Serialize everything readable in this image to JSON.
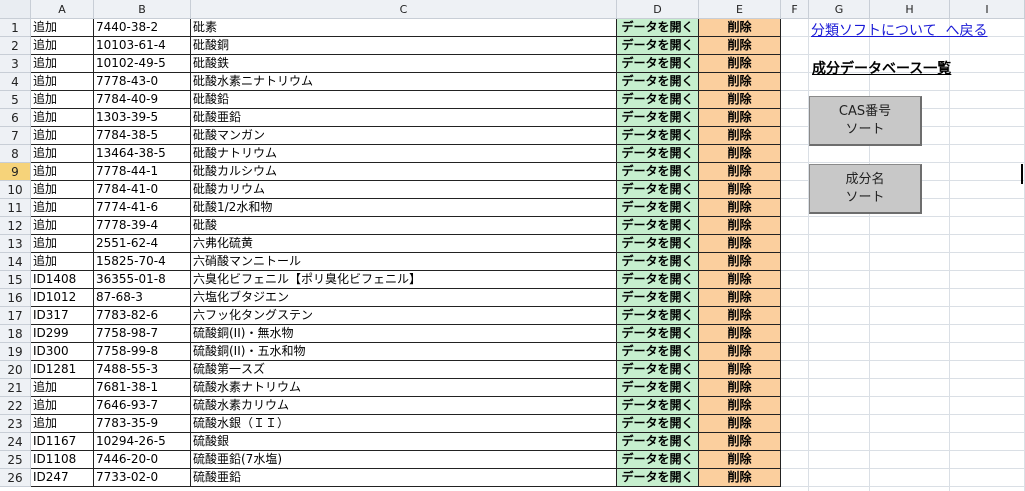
{
  "columns": [
    "A",
    "B",
    "C",
    "D",
    "E",
    "F",
    "G",
    "H",
    "I"
  ],
  "buttons": {
    "open_label": "データを開く",
    "delete_label": "削除"
  },
  "rows": [
    {
      "num": "1",
      "a": "追加",
      "b": "7440-38-2",
      "c": "砒素"
    },
    {
      "num": "2",
      "a": "追加",
      "b": "10103-61-4",
      "c": "砒酸銅"
    },
    {
      "num": "3",
      "a": "追加",
      "b": "10102-49-5",
      "c": "砒酸鉄"
    },
    {
      "num": "4",
      "a": "追加",
      "b": "7778-43-0",
      "c": "砒酸水素ニナトリウム"
    },
    {
      "num": "5",
      "a": "追加",
      "b": "7784-40-9",
      "c": "砒酸鉛"
    },
    {
      "num": "6",
      "a": "追加",
      "b": "1303-39-5",
      "c": "砒酸亜鉛"
    },
    {
      "num": "7",
      "a": "追加",
      "b": "7784-38-5",
      "c": "砒酸マンガン"
    },
    {
      "num": "8",
      "a": "追加",
      "b": "13464-38-5",
      "c": "砒酸ナトリウム"
    },
    {
      "num": "9",
      "a": "追加",
      "b": "7778-44-1",
      "c": "砒酸カルシウム"
    },
    {
      "num": "10",
      "a": "追加",
      "b": "7784-41-0",
      "c": "砒酸カリウム"
    },
    {
      "num": "11",
      "a": "追加",
      "b": "7774-41-6",
      "c": "砒酸1/2水和物"
    },
    {
      "num": "12",
      "a": "追加",
      "b": "7778-39-4",
      "c": "砒酸"
    },
    {
      "num": "13",
      "a": "追加",
      "b": "2551-62-4",
      "c": "六弗化硫黄"
    },
    {
      "num": "14",
      "a": "追加",
      "b": "15825-70-4",
      "c": "六硝酸マンニトール"
    },
    {
      "num": "15",
      "a": "ID1408",
      "b": "36355-01-8",
      "c": "六臭化ビフェニル【ポリ臭化ビフェニル】"
    },
    {
      "num": "16",
      "a": "ID1012",
      "b": "87-68-3",
      "c": "六塩化ブタジエン"
    },
    {
      "num": "17",
      "a": "ID317",
      "b": "7783-82-6",
      "c": "六フッ化タングステン"
    },
    {
      "num": "18",
      "a": "ID299",
      "b": "7758-98-7",
      "c": "硫酸銅(II)・無水物"
    },
    {
      "num": "19",
      "a": "ID300",
      "b": "7758-99-8",
      "c": "硫酸銅(II)・五水和物"
    },
    {
      "num": "20",
      "a": "ID1281",
      "b": "7488-55-3",
      "c": "硫酸第一スズ"
    },
    {
      "num": "21",
      "a": "追加",
      "b": "7681-38-1",
      "c": "硫酸水素ナトリウム"
    },
    {
      "num": "22",
      "a": "追加",
      "b": "7646-93-7",
      "c": "硫酸水素カリウム"
    },
    {
      "num": "23",
      "a": "追加",
      "b": "7783-35-9",
      "c": "硫酸水銀（ＩＩ）"
    },
    {
      "num": "24",
      "a": "ID1167",
      "b": "10294-26-5",
      "c": "硫酸銀"
    },
    {
      "num": "25",
      "a": "ID1108",
      "b": "7446-20-0",
      "c": "硫酸亜鉛(7水塩)"
    },
    {
      "num": "26",
      "a": "ID247",
      "b": "7733-02-0",
      "c": "硫酸亜鉛"
    }
  ],
  "side": {
    "link_category": "分類ソフトについて",
    "link_back": "へ戻る",
    "list_title": "成分データベース一覧",
    "cas_sort_line1": "CAS番号",
    "cas_sort_line2": "ソート",
    "name_sort_line1": "成分名",
    "name_sort_line2": "ソート"
  },
  "selected_row": "9",
  "colors": {
    "open_button": "#c6efce",
    "delete_button": "#fbcf9e",
    "selected_row_header": "#f6d37a",
    "link": "#1a1ad6"
  }
}
